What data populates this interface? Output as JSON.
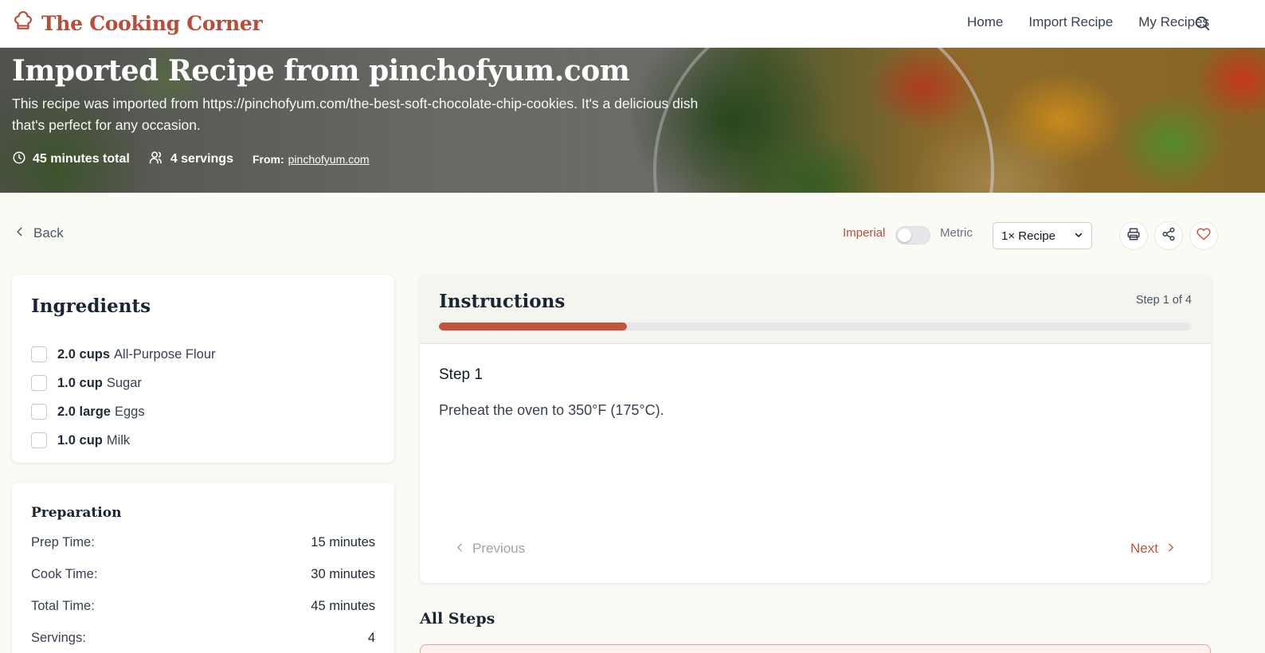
{
  "header": {
    "brand": "The Cooking Corner",
    "nav": [
      "Home",
      "Import Recipe",
      "My Recipes"
    ]
  },
  "hero": {
    "title": "Imported Recipe from pinchofyum.com",
    "description": "This recipe was imported from https://pinchofyum.com/the-best-soft-chocolate-chip-cookies. It's a delicious dish that's perfect for any occasion.",
    "total_time": "45 minutes total",
    "servings": "4 servings",
    "source_label": "From:",
    "source_link": "pinchofyum.com"
  },
  "toolbar": {
    "back": "Back",
    "unit_imperial": "Imperial",
    "unit_metric": "Metric",
    "unit_metric_selected": false,
    "scale_selected": "1× Recipe"
  },
  "ingredients": {
    "title": "Ingredients",
    "items": [
      {
        "qty": "2.0 cups",
        "name": "All-Purpose Flour"
      },
      {
        "qty": "1.0 cup",
        "name": "Sugar"
      },
      {
        "qty": "2.0 large",
        "name": "Eggs"
      },
      {
        "qty": "1.0 cup",
        "name": "Milk"
      }
    ]
  },
  "preparation": {
    "title": "Preparation",
    "rows": [
      {
        "label": "Prep Time:",
        "value": "15 minutes"
      },
      {
        "label": "Cook Time:",
        "value": "30 minutes"
      },
      {
        "label": "Total Time:",
        "value": "45 minutes"
      },
      {
        "label": "Servings:",
        "value": "4"
      }
    ]
  },
  "instructions": {
    "title": "Instructions",
    "step_counter": "Step 1 of 4",
    "progress": 0.25,
    "step_title": "Step 1",
    "step_text": "Preheat the oven to 350°F (175°C).",
    "previous": "Previous",
    "next": "Next"
  },
  "all_steps": {
    "title": "All Steps"
  },
  "colors": {
    "accent": "#c4553c",
    "brand": "#b84d3a",
    "background": "#fbfbf5"
  }
}
